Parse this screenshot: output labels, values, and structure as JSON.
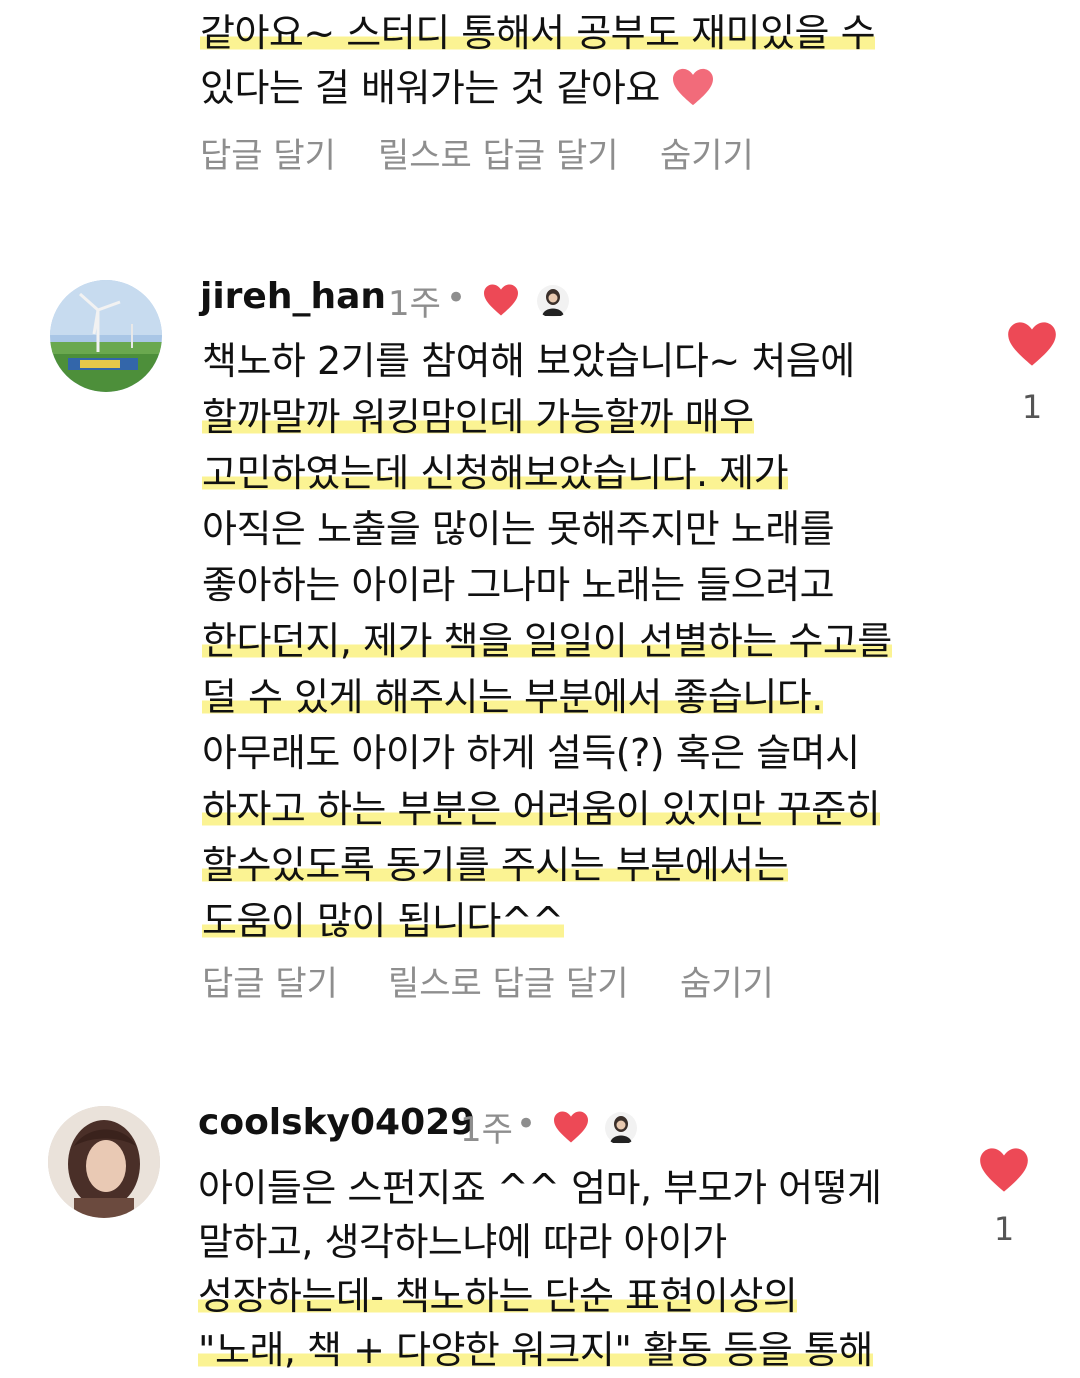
{
  "top_comment": {
    "lines": [
      "같아요~ 스터디 통해서 공부도 재미있을 수",
      "있다는 걸 배워가는 것 같아요"
    ],
    "reply_label": "답글 달기",
    "reels_reply_label": "릴스로 답글 달기",
    "hide_label": "숨기기"
  },
  "comment_1": {
    "username": "jireh_han",
    "time": "1주",
    "dot": "•",
    "lines": [
      "책노하 2기를 참여해 보았습니다~ 처음에",
      "할까말까 워킹맘인데 가능할까 매우",
      "고민하였는데 신청해보았습니다. 제가",
      "아직은 노출을 많이는 못해주지만 노래를",
      "좋아하는 아이라 그나마 노래는 들으려고",
      "한다던지, 제가 책을 일일이 선별하는 수고를",
      "덜 수 있게 해주시는 부분에서 좋습니다.",
      "아무래도 아이가 하게 설득(?) 혹은 슬며시",
      "하자고 하는 부분은 어려움이 있지만 꾸준히",
      "할수있도록 동기를 주시는 부분에서는",
      "도움이 많이 됩니다^^"
    ],
    "reply_label": "답글 달기",
    "reels_reply_label": "릴스로 답글 달기",
    "hide_label": "숨기기",
    "like_count": "1"
  },
  "comment_2": {
    "username": "coolsky04029",
    "time": "1주",
    "dot": "•",
    "lines": [
      "아이들은 스펀지죠 ^^ 엄마, 부모가 어떻게",
      "말하고, 생각하느냐에 따라 아이가",
      "성장하는데- 책노하는 단순 표현이상의",
      "\"노래, 책 + 다양한 워크지\" 활동 등을 통해"
    ],
    "like_count": "1"
  },
  "colors": {
    "heart": "#ed4956",
    "muted": "#8e8e8e",
    "highlight": "#faf078"
  },
  "icons": {
    "like": "heart-icon",
    "creator_liked": "creator-avatar-icon"
  }
}
